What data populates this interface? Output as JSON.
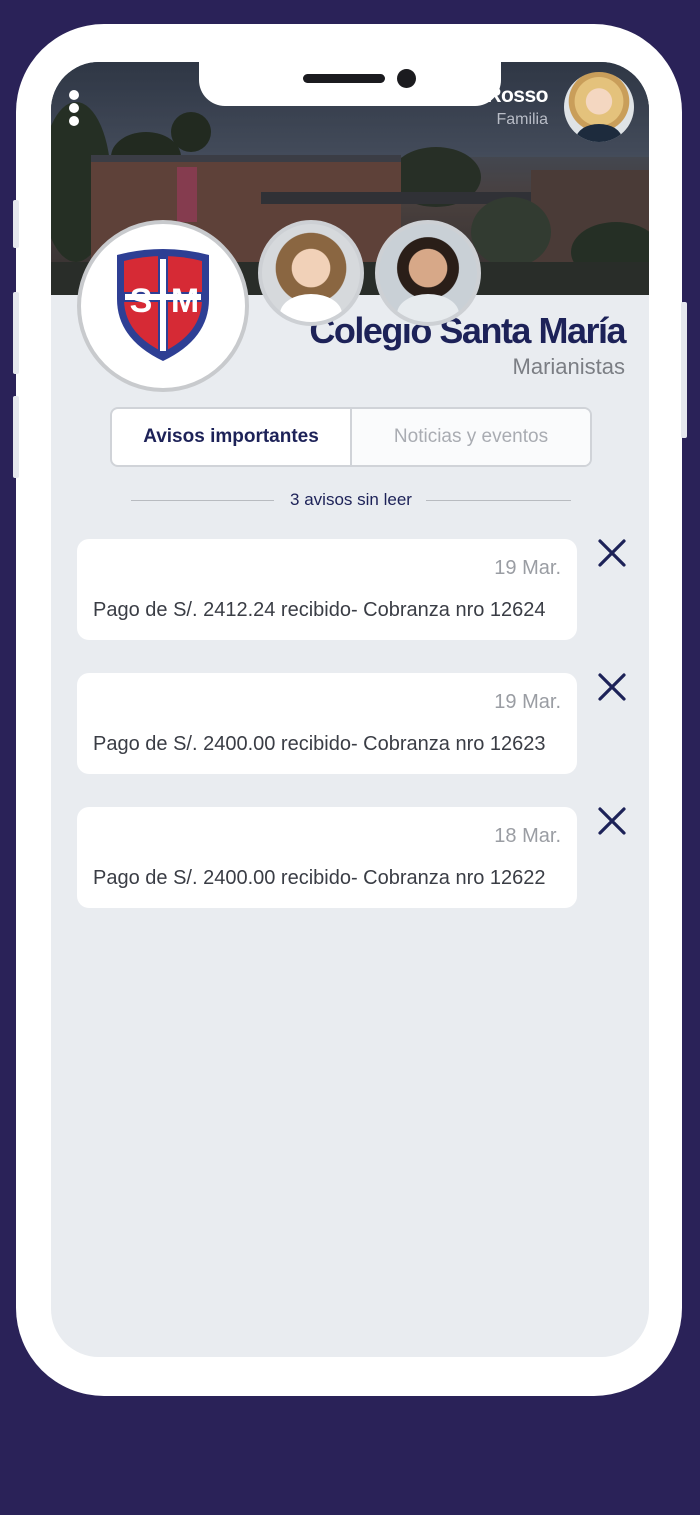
{
  "user": {
    "name": "Rosso",
    "role": "Familia"
  },
  "school": {
    "name": "Colegio Santa María",
    "subtitle": "Marianistas",
    "logo_letters": "SM"
  },
  "tabs": [
    {
      "label": "Avisos importantes",
      "active": true
    },
    {
      "label": "Noticias y eventos",
      "active": false
    }
  ],
  "unread_label": "3 avisos sin leer",
  "notices": [
    {
      "date": "19 Mar.",
      "message": "Pago de S/. 2412.24 recibido- Cobranza nro 12624"
    },
    {
      "date": "19 Mar.",
      "message": "Pago de S/. 2400.00 recibido- Cobranza nro 12623"
    },
    {
      "date": "18 Mar.",
      "message": "Pago de S/. 2400.00 recibido- Cobranza nro 12622"
    }
  ],
  "colors": {
    "background": "#2a2258",
    "brand_navy": "#1d2258",
    "shield_red": "#d62a35",
    "shield_blue": "#2e3f94"
  },
  "icons": {
    "menu": "vertical-dots-icon",
    "dismiss": "close-icon"
  }
}
